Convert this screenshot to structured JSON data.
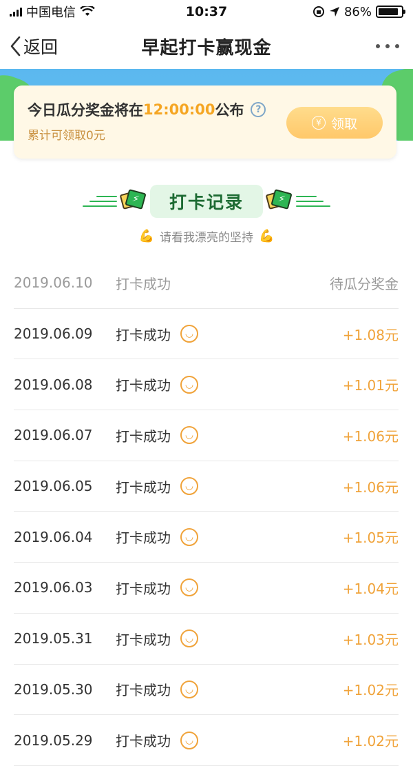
{
  "status_bar": {
    "carrier": "中国电信",
    "time": "10:37",
    "battery": "86%"
  },
  "nav": {
    "back_label": "返回",
    "title": "早起打卡赢现金"
  },
  "notice": {
    "prefix": "今日瓜分奖金将在",
    "time": "12:00:00",
    "suffix": "公布",
    "help": "?",
    "sub": "累计可领取0元",
    "claim_label": "领取",
    "yuan": "¥"
  },
  "section": {
    "title": "打卡记录",
    "subtitle": "请看我漂亮的坚持"
  },
  "records": [
    {
      "date": "2019.06.10",
      "status": "打卡成功",
      "amount": "待瓜分奖金",
      "pending": true
    },
    {
      "date": "2019.06.09",
      "status": "打卡成功",
      "amount": "+1.08元"
    },
    {
      "date": "2019.06.08",
      "status": "打卡成功",
      "amount": "+1.01元"
    },
    {
      "date": "2019.06.07",
      "status": "打卡成功",
      "amount": "+1.06元"
    },
    {
      "date": "2019.06.05",
      "status": "打卡成功",
      "amount": "+1.06元"
    },
    {
      "date": "2019.06.04",
      "status": "打卡成功",
      "amount": "+1.05元"
    },
    {
      "date": "2019.06.03",
      "status": "打卡成功",
      "amount": "+1.04元"
    },
    {
      "date": "2019.05.31",
      "status": "打卡成功",
      "amount": "+1.03元"
    },
    {
      "date": "2019.05.30",
      "status": "打卡成功",
      "amount": "+1.02元"
    },
    {
      "date": "2019.05.29",
      "status": "打卡成功",
      "amount": "+1.02元"
    }
  ],
  "colors": {
    "accent_orange": "#f0a33a",
    "brand_green": "#2db553",
    "banner_blue": "#5bb8ef"
  }
}
